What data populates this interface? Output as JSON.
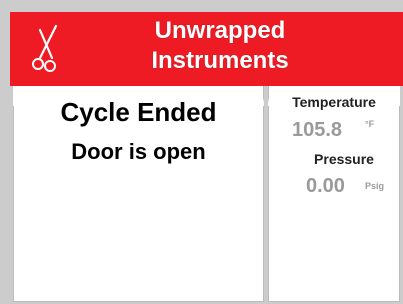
{
  "header": {
    "title": "Unwrapped\nInstruments",
    "icon": "scissors-icon",
    "background_color": "#ee1b24"
  },
  "status": {
    "line1": "Cycle Ended",
    "line2": "Door is open"
  },
  "readings": {
    "temperature": {
      "label": "Temperature",
      "value": "105.8",
      "unit": "°F"
    },
    "pressure": {
      "label": "Pressure",
      "value": "0.00",
      "unit": "Psig"
    }
  }
}
